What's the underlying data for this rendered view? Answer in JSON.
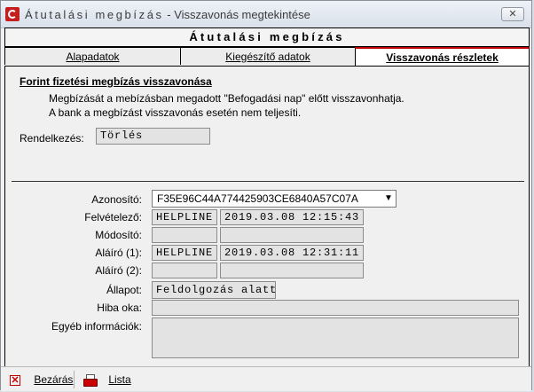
{
  "window": {
    "title_spaced": "Átutalási megbízás",
    "title_rest": " - Visszavonás megtekintése",
    "close_symbol": "✕"
  },
  "header": {
    "title": "Átutalási megbízás"
  },
  "tabs": [
    {
      "label": "Alapadatok"
    },
    {
      "label": "Kiegészítő adatok"
    },
    {
      "label": "Visszavonás részletek"
    }
  ],
  "section": {
    "title": "Forint fizetési megbízás visszavonása",
    "line1": "Megbízását a mebízásban megadott \"Befogadási nap\" előtt visszavonhatja.",
    "line2": "A bank a megbízást visszavonás esetén nem teljesíti."
  },
  "rendelkezes": {
    "label": "Rendelkezés:",
    "value": "Törlés"
  },
  "fields": {
    "azonosito_label": "Azonosító:",
    "azonosito_value": "F35E96C44A774425903CE6840A57C07A",
    "felvetelezo_label": "Felvételező:",
    "felvetelezo_user": "HELPLINE",
    "felvetelezo_time": "2019.03.08 12:15:43",
    "modosito_label": "Módosító:",
    "modosito_user": "",
    "modosito_time": "",
    "alairo1_label": "Aláíró (1):",
    "alairo1_user": "HELPLINE",
    "alairo1_time": "2019.03.08 12:31:11",
    "alairo2_label": "Aláíró (2):",
    "alairo2_user": "",
    "alairo2_time": "",
    "allapot_label": "Állapot:",
    "allapot_value": "Feldolgozás alatt",
    "hiba_label": "Hiba oka:",
    "hiba_value": "",
    "egyeb_label": "Egyéb információk:",
    "egyeb_value": ""
  },
  "bottom": {
    "close_label": "Bezárás",
    "list_label": "Lista"
  },
  "colors": {
    "active_tab_accent": "#c60000",
    "app_icon": "#c41e1e"
  }
}
